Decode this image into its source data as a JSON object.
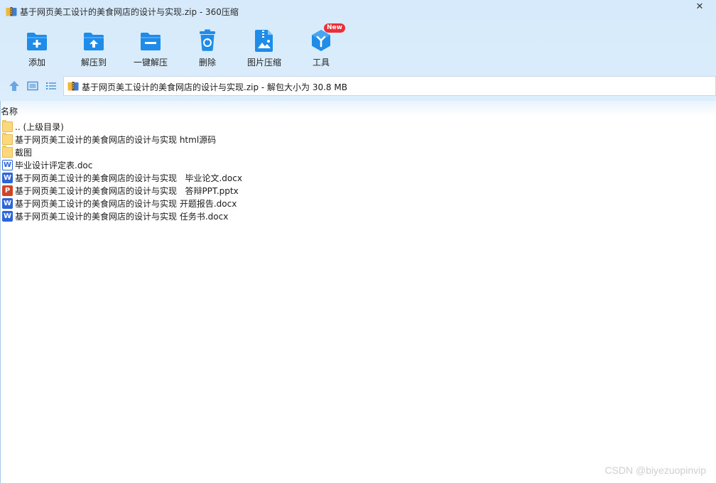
{
  "window": {
    "title": "基于网页美工设计的美食网店的设计与实现.zip - 360压缩",
    "close_glyph": "✕"
  },
  "toolbar": {
    "items": [
      {
        "label": "添加",
        "icon": "add-folder-icon"
      },
      {
        "label": "解压到",
        "icon": "extract-to-icon"
      },
      {
        "label": "一键解压",
        "icon": "one-click-extract-icon"
      },
      {
        "label": "删除",
        "icon": "trash-icon"
      },
      {
        "label": "图片压缩",
        "icon": "image-compress-icon"
      },
      {
        "label": "工具",
        "icon": "tools-cube-icon"
      }
    ],
    "new_badge": "New"
  },
  "navigation": {
    "buttons": [
      "up-arrow-icon",
      "thumbnail-view-icon",
      "list-view-icon"
    ]
  },
  "address": {
    "text": "基于网页美工设计的美食网店的设计与实现.zip - 解包大小为 30.8 MB"
  },
  "list": {
    "column_header": "名称",
    "items": [
      {
        "name": ".. (上级目录)",
        "type": "folder"
      },
      {
        "name": "基于网页美工设计的美食网店的设计与实现 html源码",
        "type": "folder"
      },
      {
        "name": "截图",
        "type": "folder"
      },
      {
        "name": "毕业设计评定表.doc",
        "type": "doc"
      },
      {
        "name": "基于网页美工设计的美食网店的设计与实现   毕业论文.docx",
        "type": "docx"
      },
      {
        "name": "基于网页美工设计的美食网店的设计与实现   答辩PPT.pptx",
        "type": "pptx"
      },
      {
        "name": "基于网页美工设计的美食网店的设计与实现 开题报告.docx",
        "type": "docx"
      },
      {
        "name": "基于网页美工设计的美食网店的设计与实现 任务书.docx",
        "type": "docx"
      }
    ]
  },
  "watermark": "CSDN @biyezuopinvip",
  "colors": {
    "accent_blue": "#1e8ce8",
    "header_bg": "#d6eafb",
    "new_badge_red": "#ea2f39",
    "word_blue": "#2b65d9",
    "ppt_red": "#d14424",
    "folder_yellow": "#fbd77d"
  }
}
